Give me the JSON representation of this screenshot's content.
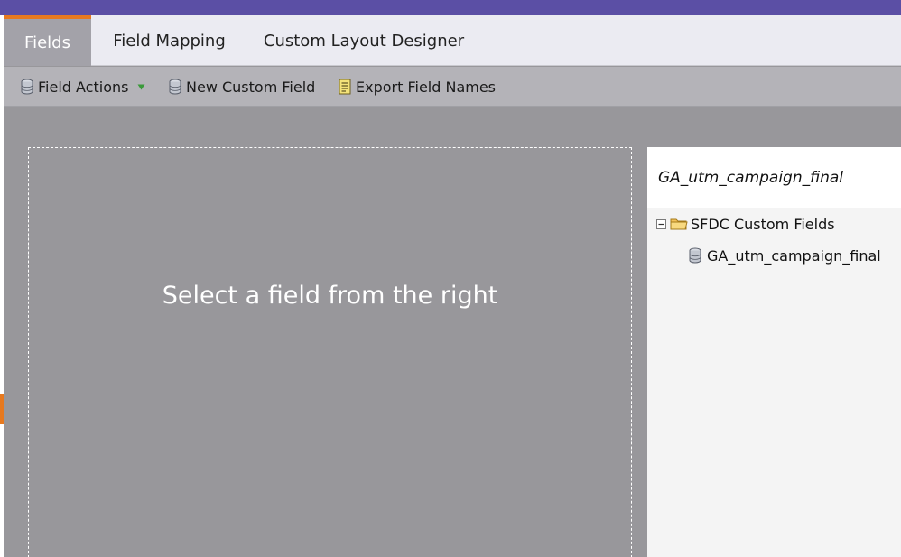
{
  "tabs": [
    {
      "label": "Fields",
      "active": true
    },
    {
      "label": "Field Mapping",
      "active": false
    },
    {
      "label": "Custom Layout Designer",
      "active": false
    }
  ],
  "toolbar": {
    "field_actions_label": "Field Actions",
    "new_custom_field_label": "New Custom Field",
    "export_field_names_label": "Export Field Names"
  },
  "main": {
    "placeholder": "Select a field from the right"
  },
  "right_panel": {
    "selected_field": "GA_utm_campaign_final",
    "tree": {
      "folder_label": "SFDC Custom Fields",
      "items": [
        {
          "label": "GA_utm_campaign_final"
        }
      ]
    }
  },
  "colors": {
    "brand_bar": "#5b4fa5",
    "accent": "#e7791f",
    "tab_active_bg": "#a3a2a9",
    "toolbar_bg": "#b4b3b8",
    "canvas_bg": "#98979b"
  },
  "icons": {
    "collapse": "minus-box-icon",
    "folder": "folder-icon",
    "field": "database-icon",
    "export": "document-icon",
    "dropdown": "triangle-down-icon"
  }
}
